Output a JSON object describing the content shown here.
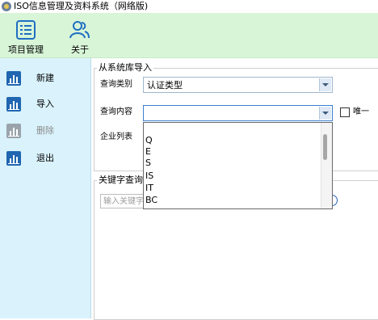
{
  "window": {
    "title": "ISO信息管理及资料系统（网络版)"
  },
  "toolbar": {
    "items": [
      {
        "label": "项目管理",
        "icon": "list-icon"
      },
      {
        "label": "关于",
        "icon": "users-icon"
      }
    ]
  },
  "sidebar": {
    "items": [
      {
        "label": "新建",
        "icon": "chart-icon",
        "enabled": true
      },
      {
        "label": "导入",
        "icon": "chart-icon",
        "enabled": true
      },
      {
        "label": "删除",
        "icon": "chart-icon",
        "enabled": false
      },
      {
        "label": "退出",
        "icon": "chart-icon",
        "enabled": true
      }
    ]
  },
  "import_panel": {
    "title": "从系统库导入",
    "category_label": "查询类别",
    "category_value": "认证类型",
    "content_label": "查询内容",
    "content_value": "",
    "unique_label": "唯一",
    "unique_checked": false,
    "company_list_label": "企业列表",
    "content_options": [
      "Q",
      "E",
      "S",
      "IS",
      "IT",
      "BC"
    ]
  },
  "keyword_panel": {
    "title": "关键字查询",
    "search_placeholder": "输入关键字"
  },
  "colors": {
    "toolbar_bg": "#d8f5d8",
    "sidebar_bg": "#d9f2fb",
    "icon_blue": "#2066b0"
  }
}
